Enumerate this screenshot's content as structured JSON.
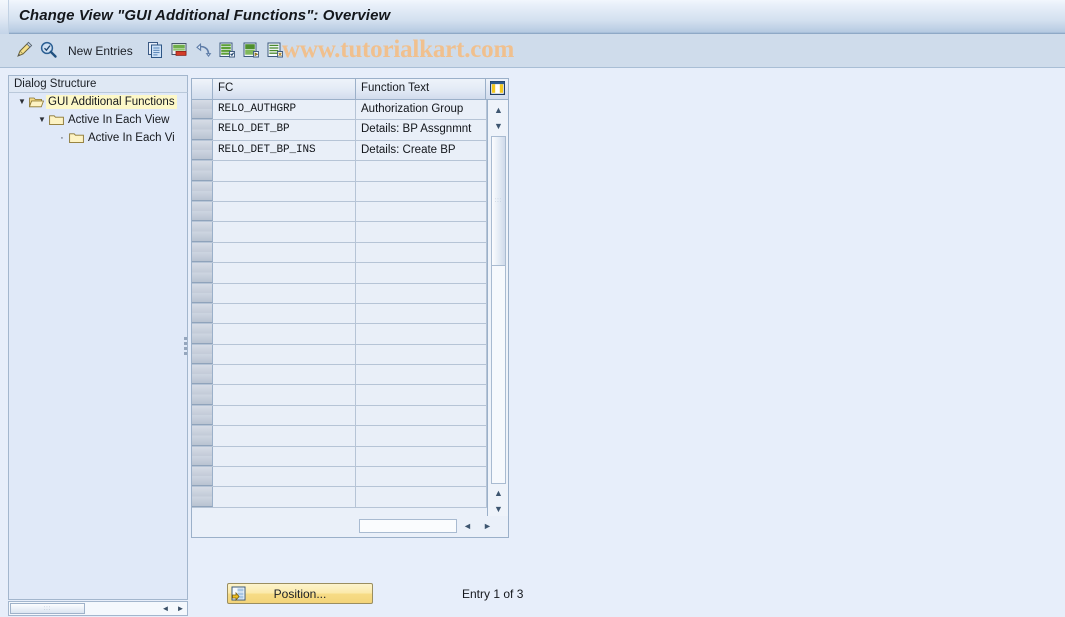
{
  "window": {
    "title": "Change View \"GUI Additional Functions\": Overview"
  },
  "toolbar": {
    "buttons": [
      {
        "name": "display-change-icon",
        "label": ""
      },
      {
        "name": "check-entries-icon",
        "label": ""
      }
    ],
    "new_entries_label": "New Entries",
    "icon_buttons": [
      {
        "name": "copy-as-icon"
      },
      {
        "name": "delete-icon"
      },
      {
        "name": "undo-icon"
      },
      {
        "name": "select-all-icon"
      },
      {
        "name": "select-block-icon"
      },
      {
        "name": "deselect-all-icon"
      }
    ]
  },
  "watermark": {
    "text": "www.tutorialkart.com"
  },
  "sidebar": {
    "header": "Dialog Structure",
    "items": [
      {
        "label": "GUI Additional Functions",
        "icon": "open-folder-icon",
        "selected": true,
        "expanded": true,
        "indent": 0
      },
      {
        "label": "Active In Each View",
        "icon": "folder-icon",
        "selected": false,
        "expanded": true,
        "indent": 1
      },
      {
        "label": "Active In Each Vi",
        "icon": "folder-icon",
        "selected": false,
        "expanded": false,
        "indent": 2
      }
    ]
  },
  "table": {
    "columns": [
      {
        "key": "fc",
        "label": "FC"
      },
      {
        "key": "function_text",
        "label": "Function Text"
      }
    ],
    "header_icon": "table-settings-icon",
    "rows": [
      {
        "fc": "RELO_AUTHGRP",
        "function_text": "Authorization Group"
      },
      {
        "fc": "RELO_DET_BP",
        "function_text": "Details: BP Assgnmnt"
      },
      {
        "fc": "RELO_DET_BP_INS",
        "function_text": "Details: Create BP"
      }
    ],
    "empty_row_count": 17,
    "scrollbar": {
      "up_arrow": "▲",
      "down_arrow": "▼",
      "left_arrow": "◄",
      "right_arrow": "►"
    }
  },
  "footer": {
    "position_button_label": "Position...",
    "entry_status": "Entry 1 of 3"
  }
}
